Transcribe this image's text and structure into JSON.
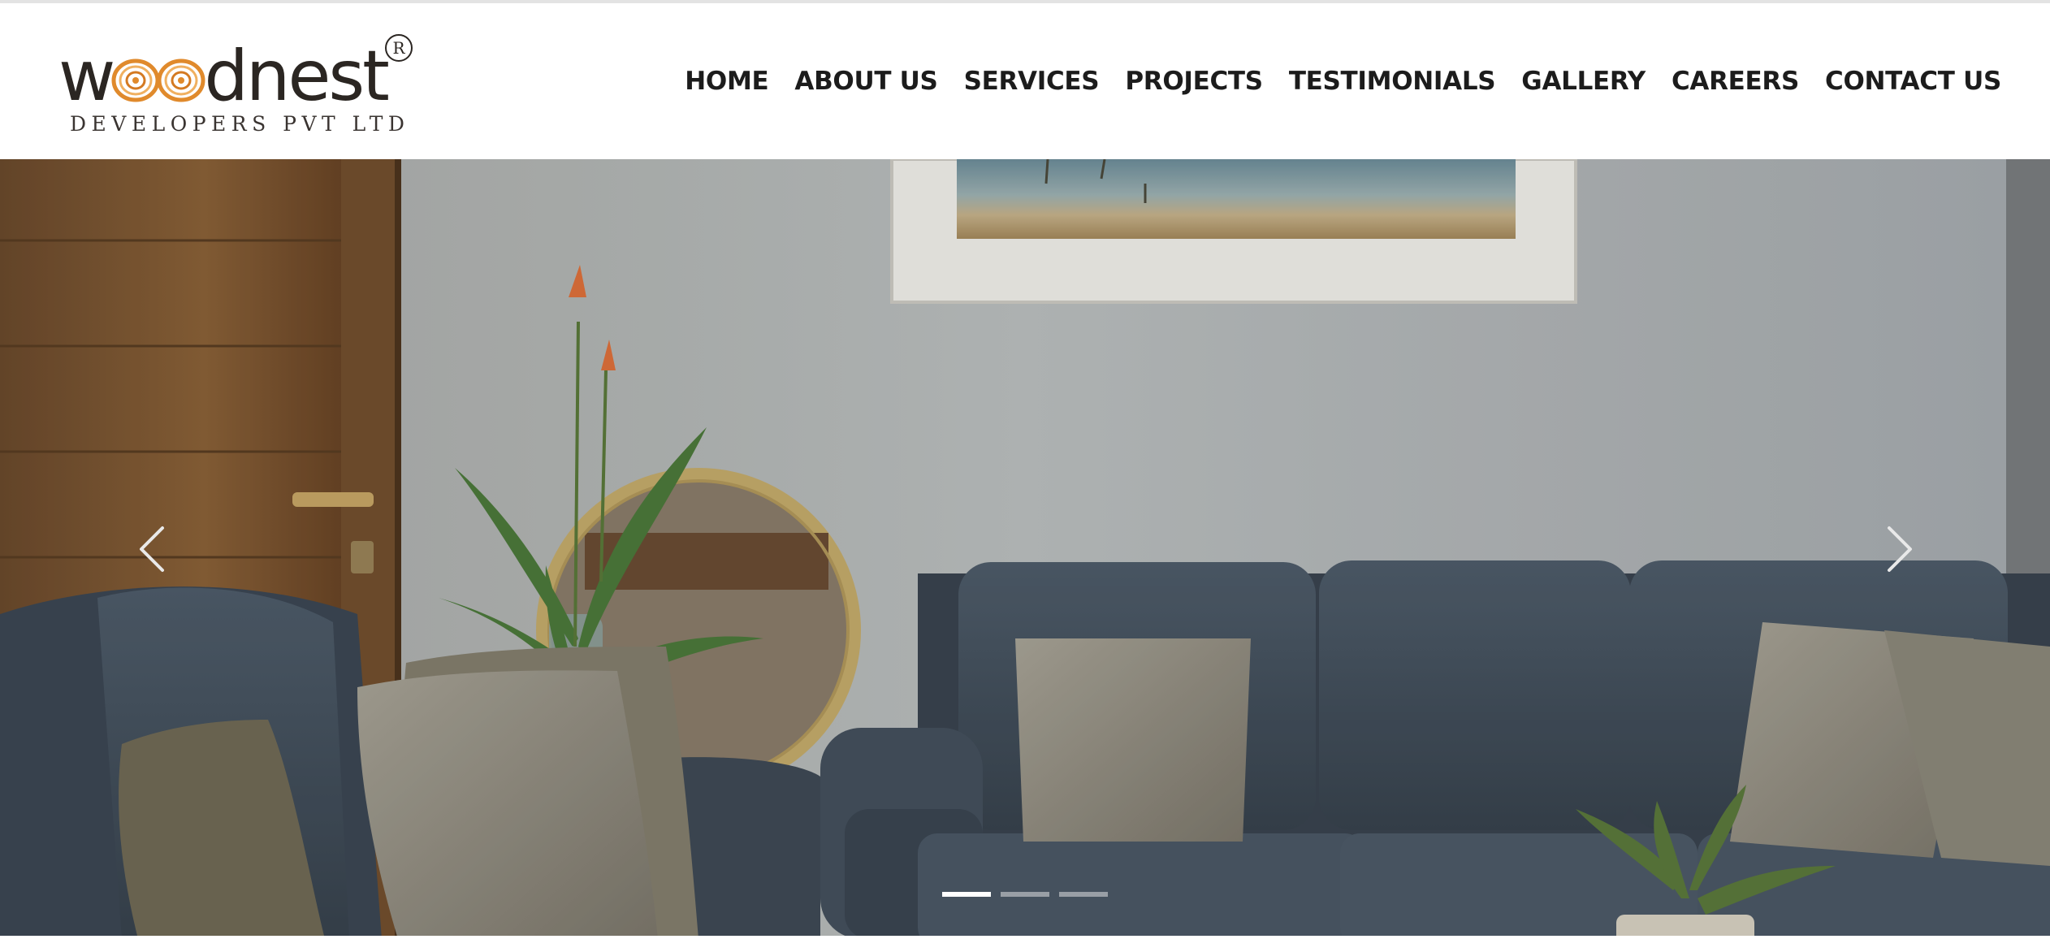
{
  "brand": {
    "name": "woodnest",
    "registered_mark": "R",
    "tagline": "DEVELOPERS PVT LTD"
  },
  "nav": {
    "items": [
      {
        "label": "HOME"
      },
      {
        "label": "ABOUT US"
      },
      {
        "label": "SERVICES"
      },
      {
        "label": "PROJECTS"
      },
      {
        "label": "TESTIMONIALS"
      },
      {
        "label": "GALLERY"
      },
      {
        "label": "CAREERS"
      },
      {
        "label": "CONTACT US"
      }
    ]
  },
  "carousel": {
    "slide_count": 3,
    "active_index": 0,
    "prev_icon": "chevron-left-icon",
    "next_icon": "chevron-right-icon",
    "slide_subject": "living room with grey leather sofa"
  },
  "colors": {
    "nav_text": "#1c1c1c",
    "logo_text": "#2b2622",
    "sofa": "#4a5866",
    "wall": "#b8bcbc",
    "wood": "#8a6238"
  }
}
